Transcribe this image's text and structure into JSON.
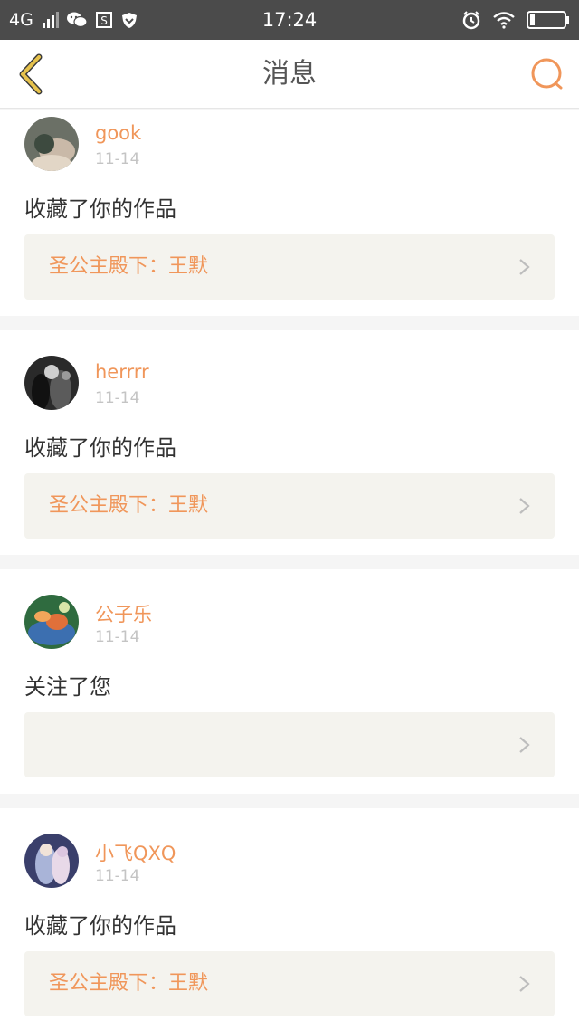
{
  "status_bar": {
    "network": "4G",
    "time": "17:24"
  },
  "nav": {
    "title": "消息"
  },
  "messages": [
    {
      "username": "gook",
      "date": "11-14",
      "action": "收藏了你的作品",
      "work_title": "圣公主殿下：王默",
      "avatar_colors": [
        "#6b7066",
        "#c9b9a8",
        "#3d4a3f"
      ]
    },
    {
      "username": "herrrr",
      "date": "11-14",
      "action": "收藏了你的作品",
      "work_title": "圣公主殿下：王默",
      "avatar_colors": [
        "#1a1a1a",
        "#5b5b5b",
        "#cfcfcf"
      ]
    },
    {
      "username": "公子乐",
      "date": "11-14",
      "action": "关注了您",
      "work_title": "",
      "avatar_colors": [
        "#2f6b3f",
        "#e0703a",
        "#3c6fb0"
      ]
    },
    {
      "username": "小飞QXQ",
      "date": "11-14",
      "action": "收藏了你的作品",
      "work_title": "圣公主殿下：王默",
      "avatar_colors": [
        "#a9b4d8",
        "#3a3f6b",
        "#e8d9e8"
      ]
    }
  ],
  "colors": {
    "accent": "#f0965a",
    "back_icon": "#e6c24c",
    "status_bar_bg": "#4b4b4b",
    "card_box_bg": "#f4f3ee"
  },
  "icons": {
    "back": "chevron-left-icon",
    "search": "search-icon",
    "row_arrow": "chevron-right-icon"
  }
}
